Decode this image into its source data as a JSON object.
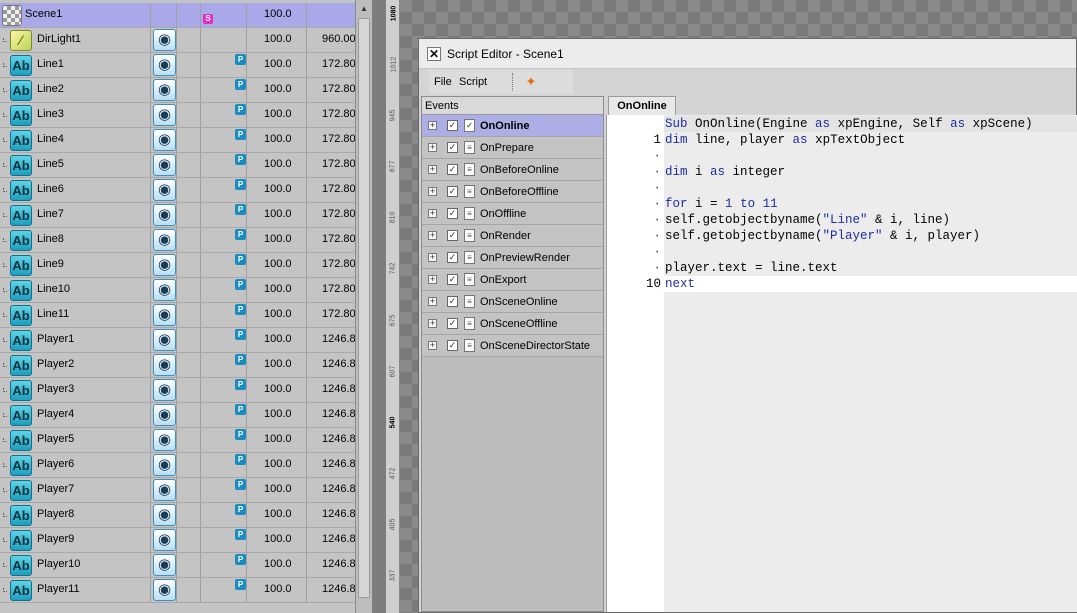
{
  "scene_tree": {
    "rows": [
      {
        "name": "Scene1",
        "type": "scene",
        "selected": true,
        "badge": "S",
        "eye": false,
        "value1": "100.0",
        "value2": ""
      },
      {
        "name": "DirLight1",
        "type": "light",
        "eye": true,
        "badge": "",
        "value1": "100.0",
        "value2": "960.00"
      },
      {
        "name": "Line1",
        "type": "text",
        "eye": true,
        "badge": "P",
        "value1": "100.0",
        "value2": "172.80"
      },
      {
        "name": "Line2",
        "type": "text",
        "eye": true,
        "badge": "P",
        "value1": "100.0",
        "value2": "172.80"
      },
      {
        "name": "Line3",
        "type": "text",
        "eye": true,
        "badge": "P",
        "value1": "100.0",
        "value2": "172.80"
      },
      {
        "name": "Line4",
        "type": "text",
        "eye": true,
        "badge": "P",
        "value1": "100.0",
        "value2": "172.80"
      },
      {
        "name": "Line5",
        "type": "text",
        "eye": true,
        "badge": "P",
        "value1": "100.0",
        "value2": "172.80"
      },
      {
        "name": "Line6",
        "type": "text",
        "eye": true,
        "badge": "P",
        "value1": "100.0",
        "value2": "172.80"
      },
      {
        "name": "Line7",
        "type": "text",
        "eye": true,
        "badge": "P",
        "value1": "100.0",
        "value2": "172.80"
      },
      {
        "name": "Line8",
        "type": "text",
        "eye": true,
        "badge": "P",
        "value1": "100.0",
        "value2": "172.80"
      },
      {
        "name": "Line9",
        "type": "text",
        "eye": true,
        "badge": "P",
        "value1": "100.0",
        "value2": "172.80"
      },
      {
        "name": "Line10",
        "type": "text",
        "eye": true,
        "badge": "P",
        "value1": "100.0",
        "value2": "172.80"
      },
      {
        "name": "Line11",
        "type": "text",
        "eye": true,
        "badge": "P",
        "value1": "100.0",
        "value2": "172.80"
      },
      {
        "name": "Player1",
        "type": "text",
        "eye": true,
        "badge": "P",
        "value1": "100.0",
        "value2": "1246.8"
      },
      {
        "name": "Player2",
        "type": "text",
        "eye": true,
        "badge": "P",
        "value1": "100.0",
        "value2": "1246.8"
      },
      {
        "name": "Player3",
        "type": "text",
        "eye": true,
        "badge": "P",
        "value1": "100.0",
        "value2": "1246.8"
      },
      {
        "name": "Player4",
        "type": "text",
        "eye": true,
        "badge": "P",
        "value1": "100.0",
        "value2": "1246.8"
      },
      {
        "name": "Player5",
        "type": "text",
        "eye": true,
        "badge": "P",
        "value1": "100.0",
        "value2": "1246.8"
      },
      {
        "name": "Player6",
        "type": "text",
        "eye": true,
        "badge": "P",
        "value1": "100.0",
        "value2": "1246.8"
      },
      {
        "name": "Player7",
        "type": "text",
        "eye": true,
        "badge": "P",
        "value1": "100.0",
        "value2": "1246.8"
      },
      {
        "name": "Player8",
        "type": "text",
        "eye": true,
        "badge": "P",
        "value1": "100.0",
        "value2": "1246.8"
      },
      {
        "name": "Player9",
        "type": "text",
        "eye": true,
        "badge": "P",
        "value1": "100.0",
        "value2": "1246.8"
      },
      {
        "name": "Player10",
        "type": "text",
        "eye": true,
        "badge": "P",
        "value1": "100.0",
        "value2": "1246.8"
      },
      {
        "name": "Player11",
        "type": "text",
        "eye": true,
        "badge": "P",
        "value1": "100.0",
        "value2": "1246.8"
      }
    ],
    "icons": {
      "text": "Ab",
      "light": "⁄",
      "eye": "◉"
    }
  },
  "ruler": {
    "labels": [
      {
        "text": "1080",
        "major": true
      },
      {
        "text": "1012",
        "major": false
      },
      {
        "text": "945",
        "major": false
      },
      {
        "text": "877",
        "major": false
      },
      {
        "text": "810",
        "major": false
      },
      {
        "text": "742",
        "major": false
      },
      {
        "text": "675",
        "major": false
      },
      {
        "text": "607",
        "major": false
      },
      {
        "text": "540",
        "major": true
      },
      {
        "text": "472",
        "major": false
      },
      {
        "text": "405",
        "major": false
      },
      {
        "text": "337",
        "major": false
      }
    ]
  },
  "editor": {
    "title": "Script Editor - Scene1",
    "menu": {
      "file": "File",
      "script": "Script"
    },
    "events_header": "Events",
    "events": [
      {
        "name": "OnOnline",
        "selected": true
      },
      {
        "name": "OnPrepare"
      },
      {
        "name": "OnBeforeOnline"
      },
      {
        "name": "OnBeforeOffline"
      },
      {
        "name": "OnOffline"
      },
      {
        "name": "OnRender"
      },
      {
        "name": "OnPreviewRender"
      },
      {
        "name": "OnExport"
      },
      {
        "name": "OnSceneOnline"
      },
      {
        "name": "OnSceneOffline"
      },
      {
        "name": "OnSceneDirectorState"
      }
    ],
    "active_tab": "OnOnline",
    "code_header": "Sub OnOnline(Engine as xpEngine, Self as xpScene)",
    "code_lines": [
      {
        "gutter": "1",
        "text": "dim line, player as xpTextObject"
      },
      {
        "gutter": "·",
        "text": ""
      },
      {
        "gutter": "·",
        "text": "dim i as integer"
      },
      {
        "gutter": "·",
        "text": ""
      },
      {
        "gutter": "·",
        "text": "for i = 1 to 11"
      },
      {
        "gutter": "·",
        "text": "self.getobjectbyname(\"Line\" & i, line)"
      },
      {
        "gutter": "·",
        "text": "self.getobjectbyname(\"Player\" & i, player)"
      },
      {
        "gutter": "·",
        "text": ""
      },
      {
        "gutter": "·",
        "text": "player.text = line.text"
      },
      {
        "gutter": "10",
        "text": "next"
      }
    ]
  }
}
